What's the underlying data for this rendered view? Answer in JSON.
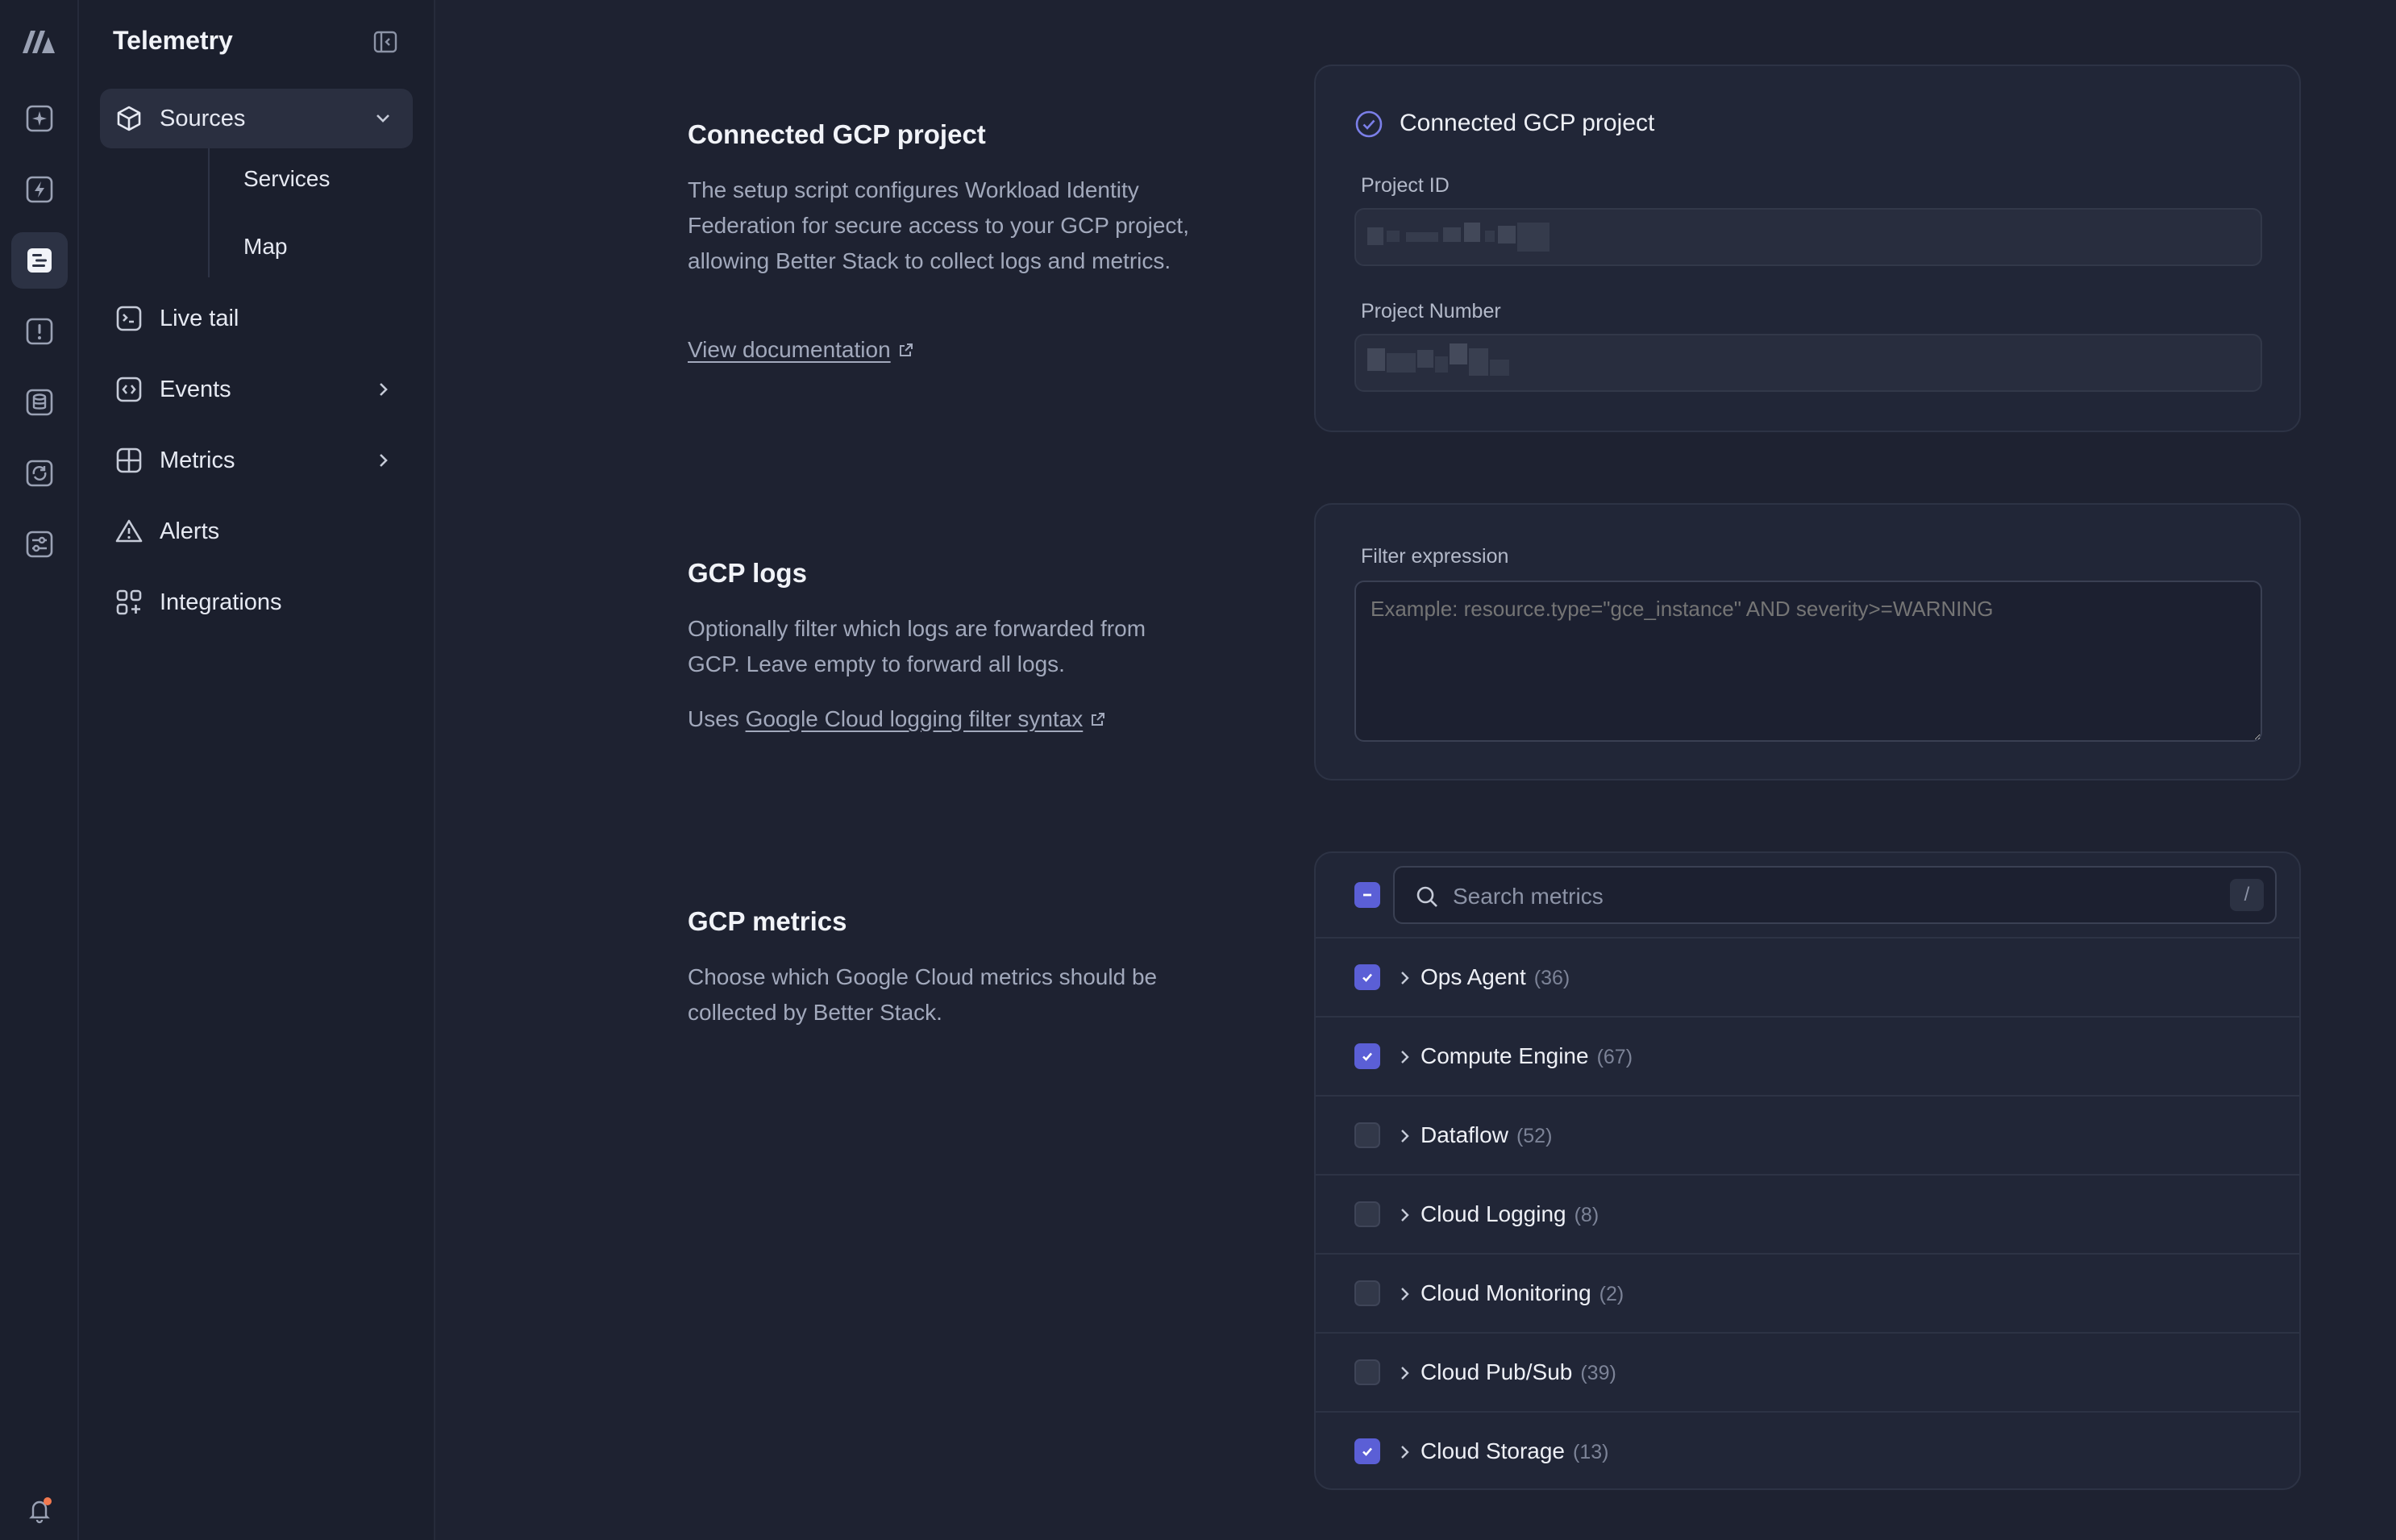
{
  "sidebar": {
    "title": "Telemetry",
    "items": [
      {
        "label": "Sources",
        "icon": "cube-icon"
      },
      {
        "label": "Live tail",
        "icon": "terminal-icon"
      },
      {
        "label": "Events",
        "icon": "code-brackets-icon"
      },
      {
        "label": "Metrics",
        "icon": "grid-icon"
      },
      {
        "label": "Alerts",
        "icon": "warning-triangle-icon"
      },
      {
        "label": "Integrations",
        "icon": "apps-plus-icon"
      }
    ],
    "sub_items": [
      "Services",
      "Map"
    ]
  },
  "connected": {
    "title": "Connected GCP project",
    "description": "The setup script configures Workload Identity Federation for secure access to your GCP project, allowing Better Stack to collect logs and metrics.",
    "doc_link": "View documentation",
    "card_title": "Connected GCP project",
    "project_id_label": "Project ID",
    "project_number_label": "Project Number"
  },
  "logs": {
    "title": "GCP logs",
    "description": "Optionally filter which logs are forwarded from GCP. Leave empty to forward all logs.",
    "uses_prefix": "Uses",
    "syntax_link": "Google Cloud logging filter syntax",
    "filter_label": "Filter expression",
    "filter_placeholder": "Example: resource.type=\"gce_instance\" AND severity>=WARNING"
  },
  "metrics": {
    "title": "GCP metrics",
    "description": "Choose which Google Cloud metrics should be collected by Better Stack.",
    "search_placeholder": "Search metrics",
    "search_shortcut": "/",
    "groups": [
      {
        "name": "Ops Agent",
        "count": "(36)",
        "checked": true
      },
      {
        "name": "Compute Engine",
        "count": "(67)",
        "checked": true
      },
      {
        "name": "Dataflow",
        "count": "(52)",
        "checked": false
      },
      {
        "name": "Cloud Logging",
        "count": "(8)",
        "checked": false
      },
      {
        "name": "Cloud Monitoring",
        "count": "(2)",
        "checked": false
      },
      {
        "name": "Cloud Pub/Sub",
        "count": "(39)",
        "checked": false
      },
      {
        "name": "Cloud Storage",
        "count": "(13)",
        "checked": true
      }
    ]
  },
  "colors": {
    "accent": "#5b5fd6",
    "background": "#1e2231",
    "card": "#212637",
    "notification_dot": "#f2794f"
  }
}
